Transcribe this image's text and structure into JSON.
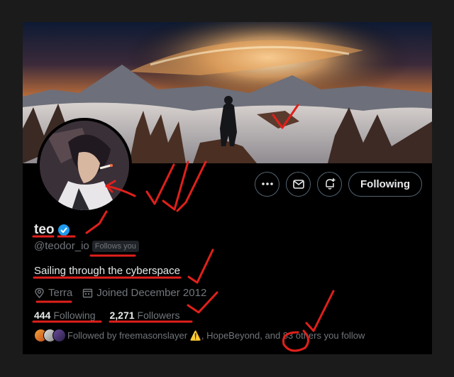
{
  "profile": {
    "name": "teo",
    "handle": "@teodor_io",
    "follows_you": "Follows you",
    "bio": "Sailing through the cyberspace",
    "location": "Terra",
    "joined": "Joined December 2012",
    "following_count": "444",
    "following_label": "Following",
    "followers_count": "2,271",
    "followers_label": "Followers",
    "followed_by": "Followed by freemasonslayer ⚠️, HopeBeyond, and 83 others you follow"
  },
  "actions": {
    "follow_label": "Following",
    "icons": [
      "more-icon",
      "message-icon",
      "notify-icon"
    ]
  },
  "colors": {
    "background": "#000000",
    "verified": "#1d9bf0",
    "annotation": "#e0201b",
    "muted_text": "#71767b"
  }
}
